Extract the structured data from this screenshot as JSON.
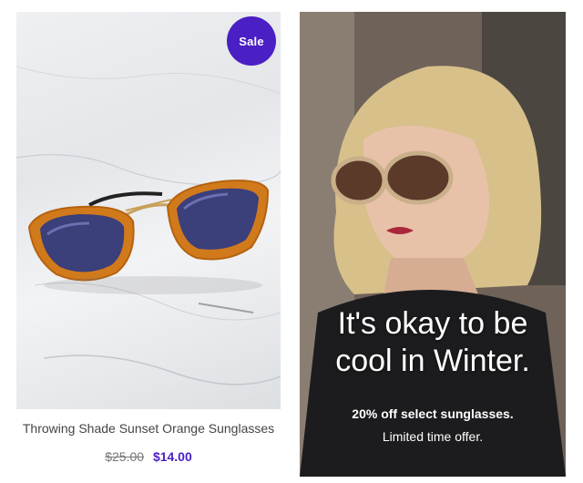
{
  "product": {
    "badge": "Sale",
    "name": "Throwing Shade Sunset Orange Sunglasses",
    "old_price": "$25.00",
    "new_price": "$14.00",
    "image_icon": "sunglasses-icon"
  },
  "promo": {
    "headline_line1": "It's okay to be",
    "headline_line2": "cool in Winter.",
    "subtext_line1": "20% off select sunglasses.",
    "subtext_line2": "Limited time offer."
  },
  "colors": {
    "accent": "#4a1fc4",
    "text": "#444444"
  }
}
